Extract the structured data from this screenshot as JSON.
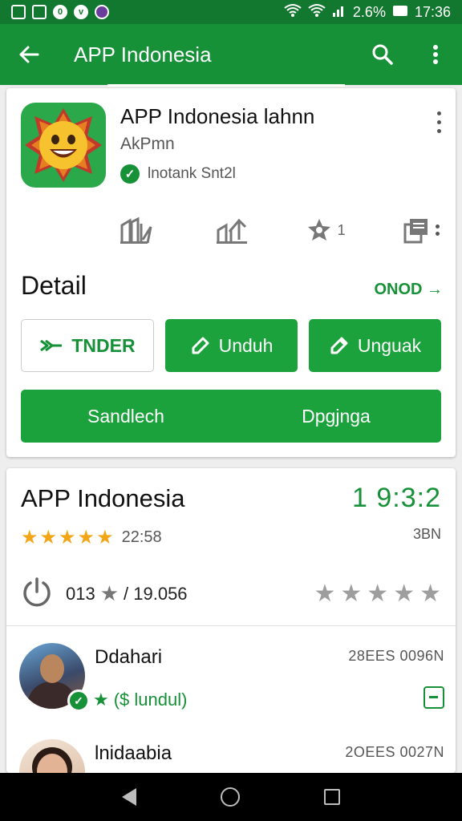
{
  "status_bar": {
    "battery": "2.6%",
    "time": "17:36",
    "app_icons": [
      "image-icon",
      "gallery-icon",
      "circle-o-icon",
      "circle-v-icon",
      "purple-app-icon"
    ]
  },
  "app_bar": {
    "title": "APP Indonesia"
  },
  "app_header": {
    "name": "APP Indonesia lahnn",
    "developer": "AkPmn",
    "verified_text": "lnotank Snt2l"
  },
  "stats": {
    "rating_count_label": "1"
  },
  "detail": {
    "title": "Detail",
    "more_label": "ONOD",
    "buttons": {
      "tender_label": "TNDER",
      "unduh_label": "Unduh",
      "unguak_label": "Unguak"
    },
    "wide_button": {
      "left_label": "Sandlech",
      "right_label": "Dpgjnga"
    }
  },
  "ratings": {
    "title": "APP Indonesia",
    "score": "1 9:3:2",
    "star_count_label": "22:58",
    "sub_label": "3BN",
    "total_prefix": "013",
    "total_suffix": "/ 19.056",
    "stars_filled": 5
  },
  "reviews": [
    {
      "name": "Ddahari",
      "meta": "28EES 0096N",
      "line_text": "($ lundul)"
    },
    {
      "name": "lnidaabia",
      "meta": "2OEES 0027N"
    }
  ],
  "colors": {
    "brand": "#169138",
    "star": "#f2a617"
  }
}
